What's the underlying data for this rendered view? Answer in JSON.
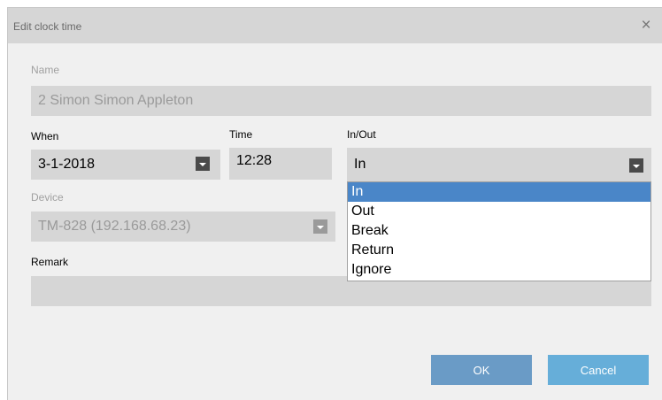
{
  "dialog": {
    "title": "Edit clock time",
    "close_glyph": "×"
  },
  "name": {
    "label": "Name",
    "value": "2 Simon Simon Appleton"
  },
  "when": {
    "label": "When",
    "value": "3-1-2018"
  },
  "time": {
    "label": "Time",
    "value": "12:28"
  },
  "inout": {
    "label": "In/Out",
    "value": "In",
    "options": [
      "In",
      "Out",
      "Break",
      "Return",
      "Ignore"
    ],
    "highlighted_option": "In"
  },
  "device": {
    "label": "Device",
    "value": "TM-828 (192.168.68.23)"
  },
  "remark": {
    "label": "Remark",
    "value": ""
  },
  "buttons": {
    "ok": "OK",
    "cancel": "Cancel"
  },
  "colors": {
    "titlebar": "#d6d6d6",
    "field_bg": "#d6d6d6",
    "selection": "#4a86c8",
    "ok_button": "#6a9bc6",
    "cancel_button": "#66aed9"
  },
  "icons": {
    "close": "close-icon",
    "dropdown": "chevron-down-icon"
  }
}
